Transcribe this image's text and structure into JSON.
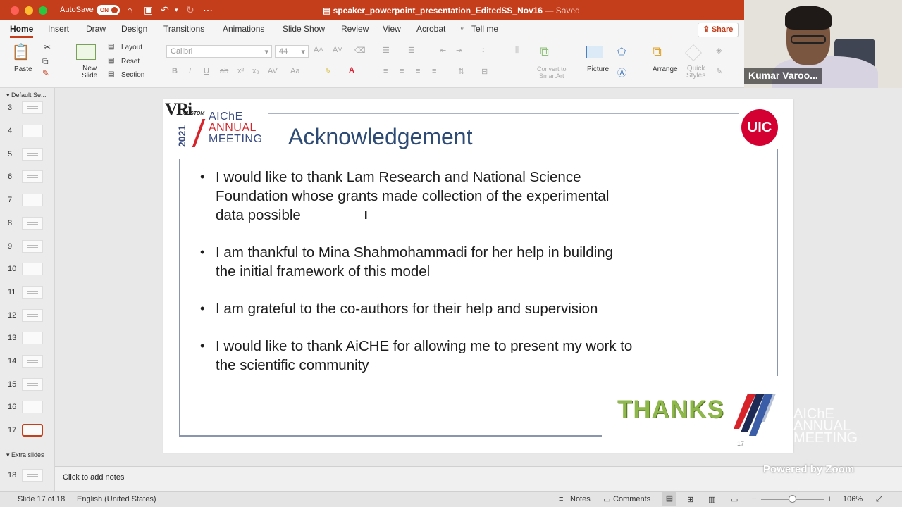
{
  "titlebar": {
    "autosave_label": "AutoSave",
    "autosave_state": "ON",
    "doc_name": "speaker_powerpoint_presentation_EditedSS_Nov16",
    "saved_status": "— Saved"
  },
  "ribbon": {
    "tabs": [
      "Home",
      "Insert",
      "Draw",
      "Design",
      "Transitions",
      "Animations",
      "Slide Show",
      "Review",
      "View",
      "Acrobat",
      "Tell me"
    ],
    "share_label": "Share",
    "paste_label": "Paste",
    "new_slide_label": "New\nSlide",
    "layout_label": "Layout",
    "reset_label": "Reset",
    "section_label": "Section",
    "font_name": "Calibri",
    "font_size": "44",
    "convert_smartart_label": "Convert to\nSmartArt",
    "picture_label": "Picture",
    "arrange_label": "Arrange",
    "quick_styles_label": "Quick\nStyles"
  },
  "slide_panel": {
    "section_default": "Default Se...",
    "section_extra": "Extra slides",
    "slide_numbers": [
      "3",
      "4",
      "5",
      "6",
      "7",
      "8",
      "9",
      "10",
      "11",
      "12",
      "13",
      "14",
      "15",
      "16",
      "17",
      "18"
    ],
    "active_slide": "17"
  },
  "slide": {
    "logo_text": "VRi",
    "logo_sub": "CUSTOM",
    "year": "2021",
    "aiche_line1": "AIChE",
    "aiche_line2": "ANNUAL",
    "aiche_line3": "MEETING",
    "title": "Acknowledgement",
    "uic_logo": "UIC",
    "bullets": [
      "I would like to thank Lam Research and National Science Foundation whose grants made collection of the experimental data possible",
      "I am thankful to Mina Shahmohammadi for her help in building the initial framework of this model",
      "I am grateful to the co-authors for their help and supervision",
      "I would like to thank AiCHE for allowing me to present my work to the scientific community"
    ],
    "thanks_text": "THANKS",
    "slide_number": "17",
    "watermark": "AIChE\nANNUAL\nMEETING"
  },
  "notes": {
    "placeholder": "Click to add notes"
  },
  "zoom_overlay": "Powered by Zoom",
  "video": {
    "participant_name": "Kumar Varoo..."
  },
  "statusbar": {
    "slide_position": "Slide 17 of 18",
    "language": "English (United States)",
    "notes_label": "Notes",
    "comments_label": "Comments",
    "zoom_level": "106%",
    "zoom_minus": "−",
    "zoom_plus": "+"
  },
  "colors": {
    "accent": "#c43e1c",
    "title_blue": "#2d4b74",
    "uic_red": "#d50032"
  }
}
